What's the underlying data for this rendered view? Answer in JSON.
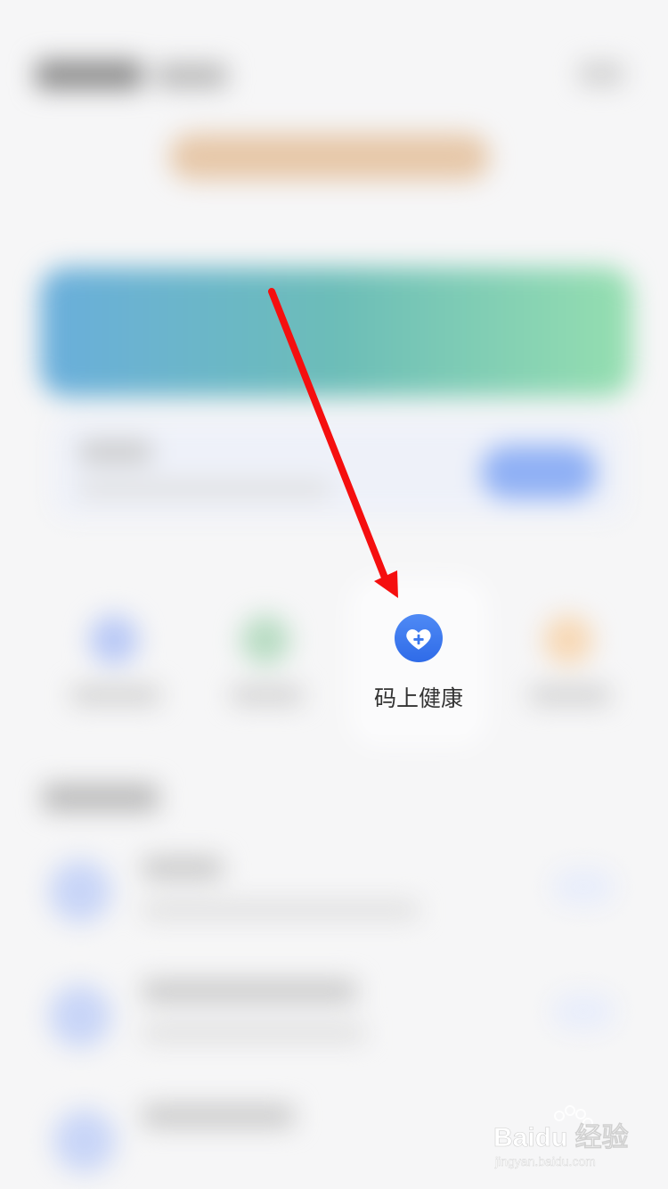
{
  "app": {
    "shortcut": {
      "label": "码上健康",
      "icon": "heart-plus-icon",
      "accent": "#3b78ee"
    }
  },
  "annotation": {
    "arrow_color": "#f50f0f"
  },
  "watermark": {
    "brand": "Baidu 经验",
    "url": "jingyan.baidu.com"
  }
}
